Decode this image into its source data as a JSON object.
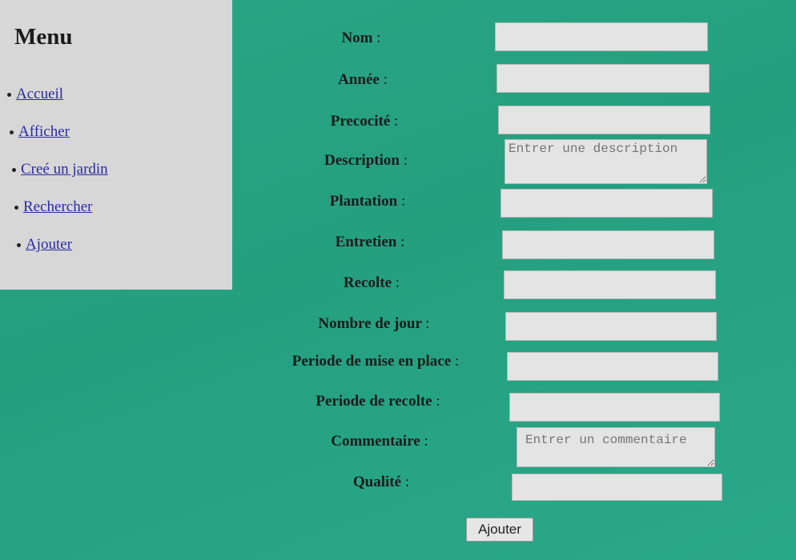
{
  "menu": {
    "title": "Menu",
    "items": [
      {
        "label": "Accueil"
      },
      {
        "label": "Afficher"
      },
      {
        "label": "Creé un jardin"
      },
      {
        "label": "Rechercher"
      },
      {
        "label": "Ajouter"
      }
    ]
  },
  "form": {
    "fields": [
      {
        "label": "Nom",
        "value": ""
      },
      {
        "label": "Année",
        "value": ""
      },
      {
        "label": "Precocité",
        "value": ""
      },
      {
        "label": "Description",
        "placeholder": "Entrer une description"
      },
      {
        "label": "Plantation",
        "value": ""
      },
      {
        "label": "Entretien",
        "value": ""
      },
      {
        "label": "Recolte",
        "value": ""
      },
      {
        "label": "Nombre de jour",
        "value": ""
      },
      {
        "label": "Periode de mise en place",
        "value": ""
      },
      {
        "label": "Periode de recolte",
        "value": ""
      },
      {
        "label": "Commentaire",
        "placeholder": "Entrer un commentaire"
      },
      {
        "label": "Qualité",
        "value": ""
      }
    ],
    "colon": ":",
    "submit_label": "Ajouter"
  }
}
